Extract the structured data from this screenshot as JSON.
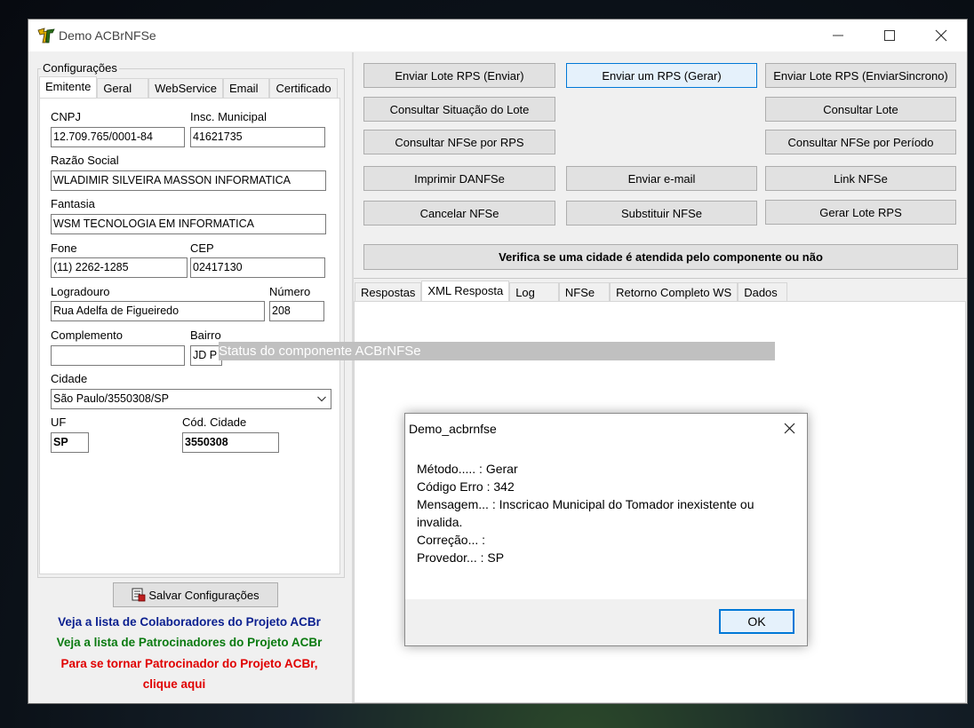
{
  "window": {
    "title": "Demo ACBrNFSe"
  },
  "left": {
    "group_title": "Configurações",
    "tabs": [
      "Emitente",
      "Geral",
      "WebService",
      "Email",
      "Certificado"
    ],
    "fields": {
      "cnpj": {
        "label": "CNPJ",
        "value": "12.709.765/0001-84"
      },
      "insc_municipal": {
        "label": "Insc. Municipal",
        "value": "41621735"
      },
      "razao_social": {
        "label": "Razão Social",
        "value": "WLADIMIR SILVEIRA MASSON INFORMATICA"
      },
      "fantasia": {
        "label": "Fantasia",
        "value": "WSM TECNOLOGIA EM INFORMATICA"
      },
      "fone": {
        "label": "Fone",
        "value": "(11) 2262-1285"
      },
      "cep": {
        "label": "CEP",
        "value": "02417130"
      },
      "logradouro": {
        "label": "Logradouro",
        "value": "Rua Adelfa de Figueiredo"
      },
      "numero": {
        "label": "Número",
        "value": "208"
      },
      "complemento": {
        "label": "Complemento",
        "value": ""
      },
      "bairro": {
        "label": "Bairro",
        "value": "JD P"
      },
      "cidade": {
        "label": "Cidade",
        "value": "São Paulo/3550308/SP"
      },
      "uf": {
        "label": "UF",
        "value": "SP"
      },
      "cod_cidade": {
        "label": "Cód. Cidade",
        "value": "3550308"
      }
    },
    "save_button": "Salvar Configurações",
    "links": {
      "colaboradores": "Veja a lista de Colaboradores do Projeto ACBr",
      "patrocinadores": "Veja a lista de Patrocinadores do Projeto ACBr",
      "tornar_1": "Para se tornar Patrocinador do Projeto ACBr,",
      "tornar_2": "clique aqui"
    },
    "colors": {
      "link_blue": "#0a1f8f",
      "link_green": "#0a7a10",
      "link_red": "#e00000"
    }
  },
  "right": {
    "buttons": {
      "enviar_lote": "Enviar Lote RPS (Enviar)",
      "enviar_rps": "Enviar um RPS (Gerar)",
      "enviar_lote_sinc": "Enviar Lote RPS (EnviarSincrono)",
      "consultar_situacao": "Consultar Situação do Lote",
      "consultar_lote": "Consultar Lote",
      "consultar_nfse_rps": "Consultar NFSe por RPS",
      "consultar_nfse_periodo": "Consultar NFSe por Período",
      "imprimir": "Imprimir DANFSe",
      "enviar_email": "Enviar e-mail",
      "link_nfse": "Link NFSe",
      "cancelar": "Cancelar NFSe",
      "substituir": "Substituir NFSe",
      "gerar_lote": "Gerar Lote RPS",
      "verifica_cidade": "Verifica se uma cidade é atendida pelo componente ou não"
    },
    "tabs": [
      "Respostas",
      "XML Resposta",
      "Log",
      "NFSe",
      "Retorno Completo WS",
      "Dados"
    ],
    "active_tab": "XML Resposta"
  },
  "status_text": "Status do componente ACBrNFSe",
  "dialog": {
    "title": "Demo_acbrnfse",
    "lines": [
      "Método..... : Gerar",
      "Código Erro : 342",
      "Mensagem... : Inscricao Municipal do Tomador inexistente ou",
      "invalida.",
      "Correção... :",
      "Provedor... : SP"
    ],
    "ok_label": "OK"
  }
}
